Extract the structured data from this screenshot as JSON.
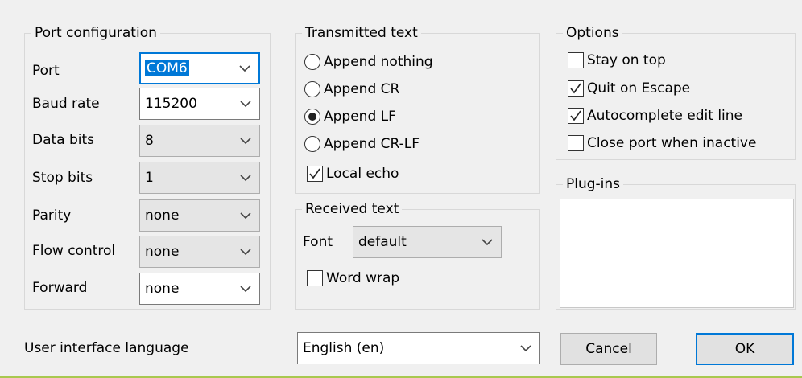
{
  "port_config": {
    "title": "Port configuration",
    "rows": [
      {
        "label": "Port",
        "value": "COM6"
      },
      {
        "label": "Baud rate",
        "value": "115200"
      },
      {
        "label": "Data bits",
        "value": "8"
      },
      {
        "label": "Stop bits",
        "value": "1"
      },
      {
        "label": "Parity",
        "value": "none"
      },
      {
        "label": "Flow control",
        "value": "none"
      },
      {
        "label": "Forward",
        "value": "none"
      }
    ]
  },
  "transmitted": {
    "title": "Transmitted text",
    "options": [
      "Append nothing",
      "Append CR",
      "Append LF",
      "Append CR-LF"
    ],
    "selected": "Append LF",
    "local_echo_label": "Local echo",
    "local_echo_checked": true
  },
  "received": {
    "title": "Received text",
    "font_label": "Font",
    "font_value": "default",
    "word_wrap_label": "Word wrap",
    "word_wrap_checked": false
  },
  "options": {
    "title": "Options",
    "items": [
      {
        "label": "Stay on top",
        "checked": false
      },
      {
        "label": "Quit on Escape",
        "checked": true
      },
      {
        "label": "Autocomplete edit line",
        "checked": true
      },
      {
        "label": "Close port when inactive",
        "checked": false
      }
    ]
  },
  "plugins": {
    "title": "Plug-ins"
  },
  "language": {
    "label": "User interface language",
    "value": "English (en)"
  },
  "buttons": {
    "cancel": "Cancel",
    "ok": "OK"
  }
}
